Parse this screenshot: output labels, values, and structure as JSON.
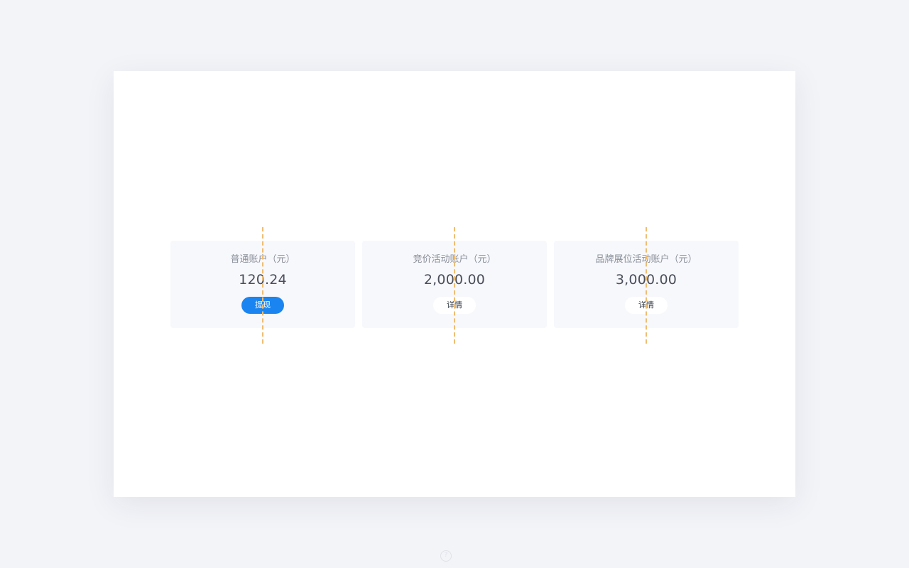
{
  "accounts": [
    {
      "title": "普通账户（元）",
      "value": "120.24",
      "button_label": "提现",
      "button_style": "primary"
    },
    {
      "title": "竞价活动账户（元）",
      "value": "2,000.00",
      "button_label": "详情",
      "button_style": "plain"
    },
    {
      "title": "品牌展位活动账户（元）",
      "value": "3,000.00",
      "button_label": "详情",
      "button_style": "plain"
    }
  ],
  "footer": {
    "icon": "help-icon",
    "glyph": "?"
  },
  "colors": {
    "primary": "#1a85f0",
    "guide": "#efbd70",
    "card_bg": "#f7f8fc",
    "page_bg": "#f3f4f8"
  }
}
